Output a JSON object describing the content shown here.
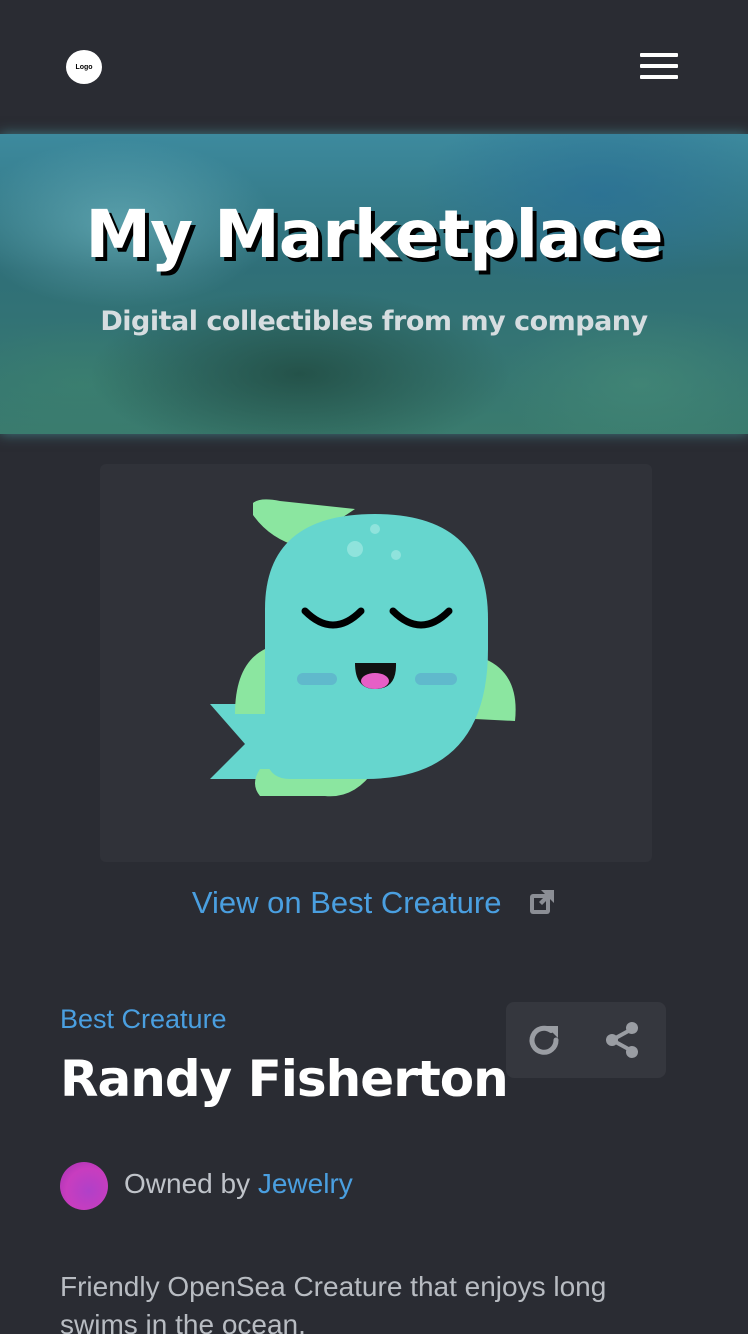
{
  "header": {
    "logo_text": "Logo",
    "menu_icon": "hamburger-menu-icon"
  },
  "hero": {
    "title": "My Marketplace",
    "subtitle": "Digital collectibles from my company"
  },
  "asset": {
    "image_icon": "fish-creature-illustration",
    "view_link": "View on Best Creature",
    "external_icon": "external-link-icon",
    "collection": "Best Creature",
    "name": "Randy Fisherton",
    "owner_prefix": "Owned by",
    "owner_name": "Jewelry",
    "description": "Friendly OpenSea Creature that enjoys long swims in the ocean."
  },
  "actions": {
    "refresh_icon": "refresh-icon",
    "share_icon": "share-icon"
  },
  "colors": {
    "background": "#2a2c33",
    "link": "#4a9fe0",
    "card": "#303239",
    "creature_body": "#66d6ce",
    "creature_fin": "#8be6a0",
    "avatar": "#c83dbf"
  }
}
